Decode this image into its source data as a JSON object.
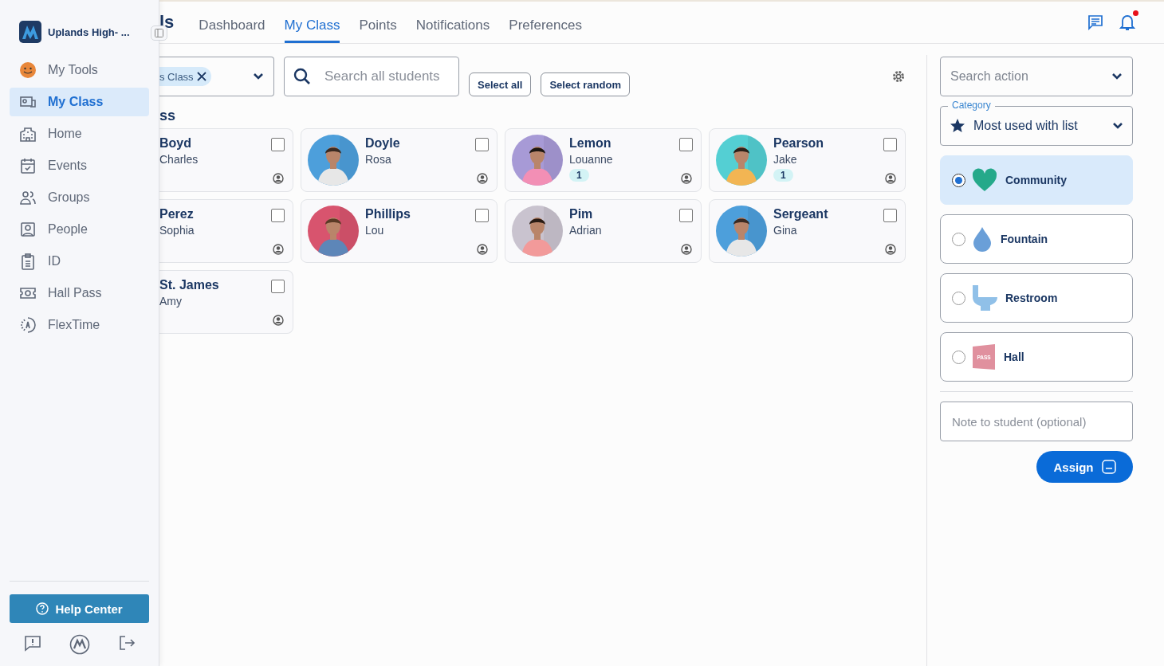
{
  "sidebar": {
    "school": "Uplands High- ...",
    "items": [
      {
        "label": "My Tools",
        "kind": "emoji",
        "selected": false
      },
      {
        "label": "My Class",
        "kind": "class",
        "selected": true
      },
      {
        "label": "Home",
        "kind": "school",
        "selected": false
      },
      {
        "label": "Events",
        "kind": "calendar",
        "selected": false
      },
      {
        "label": "Groups",
        "kind": "users",
        "selected": false
      },
      {
        "label": "People",
        "kind": "person",
        "selected": false
      },
      {
        "label": "ID",
        "kind": "id",
        "selected": false
      },
      {
        "label": "Hall Pass",
        "kind": "pass",
        "selected": false
      },
      {
        "label": "FlexTime",
        "kind": "flex",
        "selected": false
      }
    ],
    "help": "Help Center"
  },
  "header": {
    "title": "ls",
    "tabs": [
      {
        "label": "Dashboard",
        "selected": false
      },
      {
        "label": "My Class",
        "selected": true
      },
      {
        "label": "Points",
        "selected": false
      },
      {
        "label": "Notifications",
        "selected": false
      },
      {
        "label": "Preferences",
        "selected": false
      }
    ],
    "has_unread": true
  },
  "filters": {
    "class_chip": "s Class",
    "search_placeholder": "Search all students",
    "select_all": "Select all",
    "select_random": "Select random"
  },
  "section_title": "ss",
  "students": [
    {
      "last": "Boyd",
      "first": "Charles",
      "checked": false
    },
    {
      "last": "Doyle",
      "first": "Rosa",
      "checked": false
    },
    {
      "last": "Lemon",
      "first": "Louanne",
      "checked": false,
      "badge": "1"
    },
    {
      "last": "Pearson",
      "first": "Jake",
      "checked": false,
      "badge": "1"
    },
    {
      "last": "Perez",
      "first": "Sophia",
      "checked": false
    },
    {
      "last": "Phillips",
      "first": "Lou",
      "checked": false
    },
    {
      "last": "Pim",
      "first": "Adrian",
      "checked": false
    },
    {
      "last": "Sergeant",
      "first": "Gina",
      "checked": false
    },
    {
      "last": "St. James",
      "first": "Amy",
      "checked": false
    }
  ],
  "actions_panel": {
    "search_placeholder": "Search action",
    "category_label": "Category",
    "category_value": "Most used with list",
    "actions": [
      {
        "label": "Community",
        "kind": "heart",
        "selected": true
      },
      {
        "label": "Fountain",
        "kind": "drop",
        "selected": false
      },
      {
        "label": "Restroom",
        "kind": "toilet",
        "selected": false
      },
      {
        "label": "Hall",
        "kind": "pass",
        "icon_text": "PASS",
        "selected": false
      }
    ],
    "note_placeholder": "Note to student (optional)",
    "assign": "Assign"
  }
}
